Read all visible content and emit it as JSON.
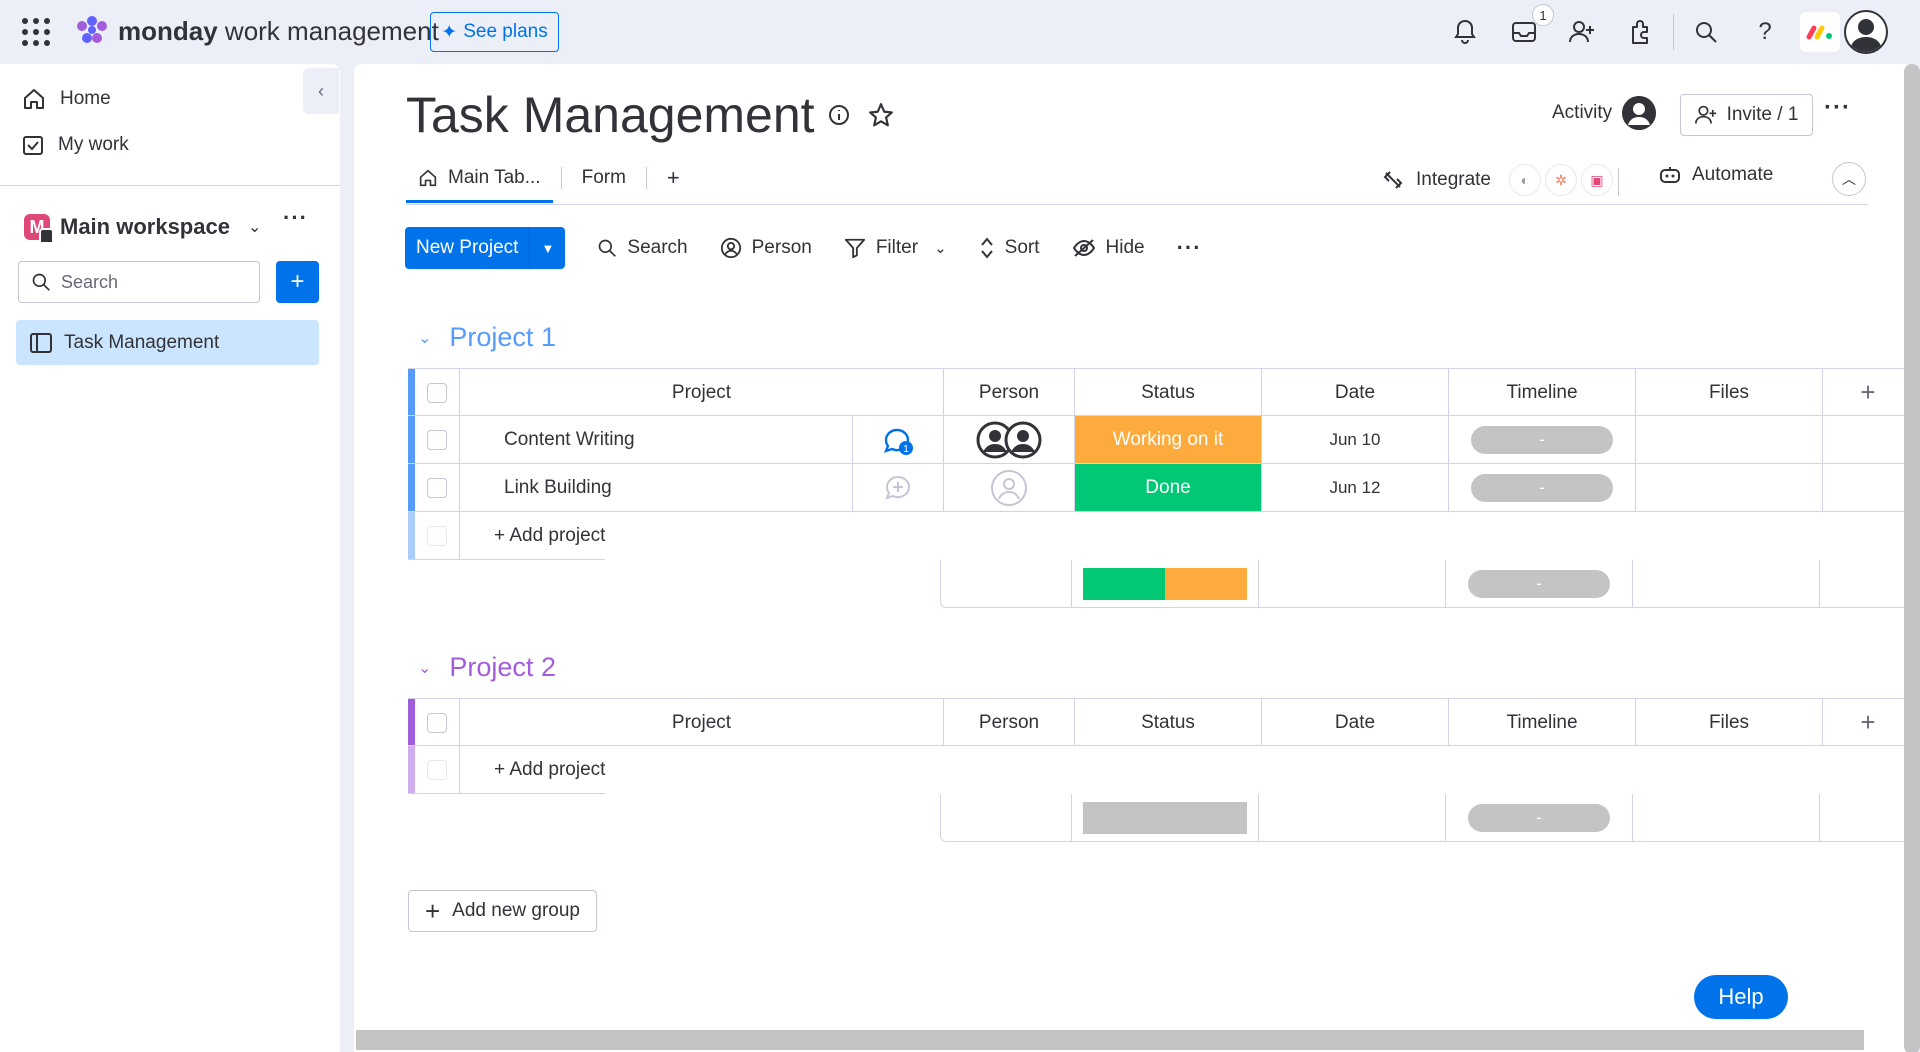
{
  "topbar": {
    "brand_bold": "monday",
    "brand_rest": " work management",
    "see_plans": "See plans",
    "inbox_badge": "1"
  },
  "sidebar": {
    "home": "Home",
    "my_work": "My work",
    "workspace_initial": "M",
    "workspace_name": "Main workspace",
    "search_placeholder": "Search",
    "board": "Task Management"
  },
  "board": {
    "title": "Task Management",
    "activity": "Activity",
    "invite": "Invite / 1",
    "tabs": [
      "Main Tab...",
      "Form"
    ],
    "integrate": "Integrate",
    "automate": "Automate"
  },
  "toolbar": {
    "new_project": "New Project",
    "search": "Search",
    "person": "Person",
    "filter": "Filter",
    "sort": "Sort",
    "hide": "Hide"
  },
  "columns": [
    "Project",
    "Person",
    "Status",
    "Date",
    "Timeline",
    "Files"
  ],
  "groups": [
    {
      "name": "Project 1",
      "color": "#579bfc",
      "items": [
        {
          "name": "Content Writing",
          "status": "Working on it",
          "status_color": "#fdab3d",
          "date": "Jun 10",
          "timeline": "-",
          "updates": "1"
        },
        {
          "name": "Link Building",
          "status": "Done",
          "status_color": "#00c875",
          "date": "Jun 12",
          "timeline": "-"
        }
      ],
      "add_label": "+ Add project",
      "summary_timeline": "-"
    },
    {
      "name": "Project 2",
      "color": "#a25ddc",
      "items": [],
      "add_label": "+ Add project",
      "summary_timeline": "-"
    }
  ],
  "add_group": "Add new group",
  "help": "Help",
  "colors": {
    "accent": "#0073ea",
    "working": "#fdab3d",
    "done": "#00c875",
    "group1": "#579bfc",
    "group2": "#a25ddc"
  }
}
